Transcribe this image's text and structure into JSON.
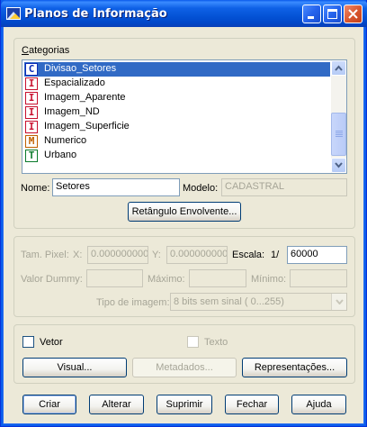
{
  "window": {
    "title": "Planos de Informação"
  },
  "categories": {
    "label": "Categorias",
    "items": [
      {
        "icon_letter": "C",
        "icon_name": "category-c-icon",
        "color": "#0b2bb8",
        "label": "Divisao_Setores",
        "selected": true
      },
      {
        "icon_letter": "I",
        "icon_name": "category-i-icon",
        "color": "#c8102e",
        "label": "Espacializado"
      },
      {
        "icon_letter": "I",
        "icon_name": "category-i-icon",
        "color": "#c8102e",
        "label": "Imagem_Aparente"
      },
      {
        "icon_letter": "I",
        "icon_name": "category-i-icon",
        "color": "#c8102e",
        "label": "Imagem_ND"
      },
      {
        "icon_letter": "I",
        "icon_name": "category-i-icon",
        "color": "#c8102e",
        "label": "Imagem_Superficie"
      },
      {
        "icon_letter": "M",
        "icon_name": "category-m-icon",
        "color": "#c06000",
        "label": "Numerico"
      },
      {
        "icon_letter": "T",
        "icon_name": "category-t-icon",
        "color": "#0a7a2a",
        "label": "Urbano"
      }
    ]
  },
  "name_field": {
    "label": "Nome:",
    "value": "Setores"
  },
  "model_field": {
    "label": "Modelo:",
    "value": "CADASTRAL"
  },
  "envelope_button": "Retângulo Envolvente...",
  "image_params": {
    "pixel_label": "Tam. Pixel:",
    "x_label": "X:",
    "x_value": "0.000000000",
    "y_label": "Y:",
    "y_value": "0.000000000",
    "scale_label": "Escala:",
    "scale_prefix": "1/",
    "scale_value": "60000",
    "dummy_label": "Valor Dummy:",
    "dummy_value": "",
    "max_label": "Máximo:",
    "max_value": "",
    "min_label": "Mínimo:",
    "min_value": "",
    "type_label": "Tipo de imagem:",
    "type_value": "8 bits sem sinal ( 0...255)"
  },
  "display": {
    "vector_label": "Vetor",
    "text_label": "Texto",
    "visual_button": "Visual...",
    "metadata_button": "Metadados...",
    "representations_button": "Representações..."
  },
  "actions": {
    "create": "Criar",
    "change": "Alterar",
    "delete": "Suprimir",
    "close": "Fechar",
    "help": "Ajuda"
  }
}
